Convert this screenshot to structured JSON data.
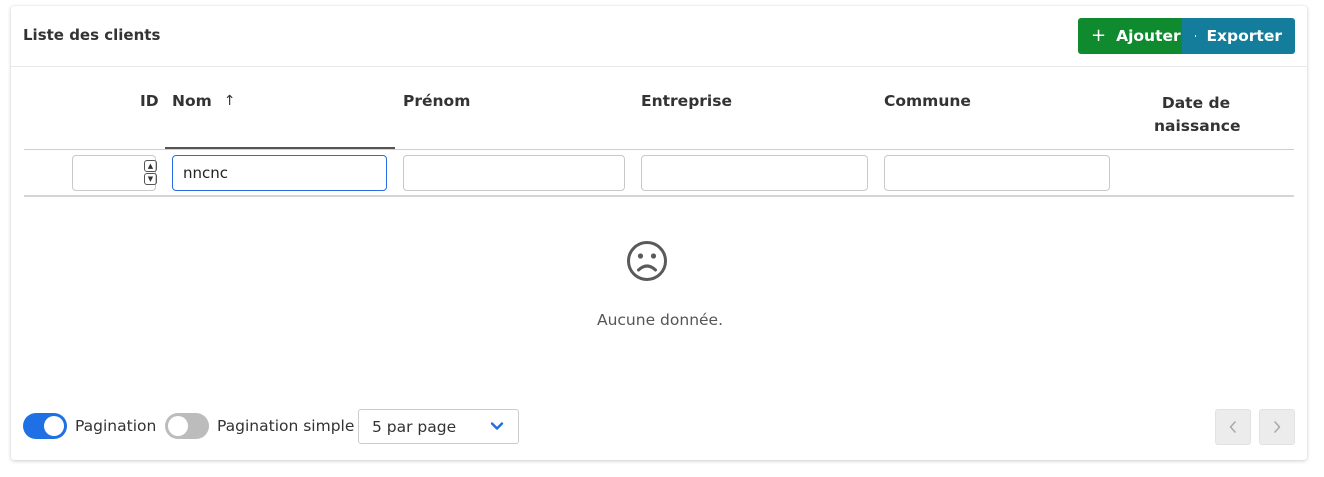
{
  "header": {
    "title": "Liste des clients",
    "add_button": {
      "label": "Ajouter",
      "icon": "plus-icon",
      "color": "#0f8a2e"
    },
    "export_button": {
      "label": "Exporter",
      "icon": "file-icon",
      "color": "#157d9c"
    }
  },
  "table": {
    "columns": [
      {
        "key": "id",
        "label": "ID"
      },
      {
        "key": "nom",
        "label": "Nom",
        "sort": "ascending"
      },
      {
        "key": "prenom",
        "label": "Prénom"
      },
      {
        "key": "entreprise",
        "label": "Entreprise"
      },
      {
        "key": "commune",
        "label": "Commune"
      },
      {
        "key": "date_naissance",
        "label": "Date de naissance"
      }
    ],
    "filters": {
      "id": "",
      "nom": "nncnc",
      "prenom": "",
      "entreprise": "",
      "commune": ""
    },
    "empty": {
      "icon": "sad-face-icon",
      "message": "Aucune donnée."
    }
  },
  "footer": {
    "pagination_toggle": {
      "label": "Pagination",
      "on": true
    },
    "simple_pagination_toggle": {
      "label": "Pagination simple",
      "on": false
    },
    "per_page": {
      "selected": "5 par page"
    },
    "prev_icon": "chevron-left-icon",
    "next_icon": "chevron-right-icon"
  },
  "colors": {
    "accent": "#1f6fe5",
    "add": "#0f8a2e",
    "export": "#157d9c"
  }
}
